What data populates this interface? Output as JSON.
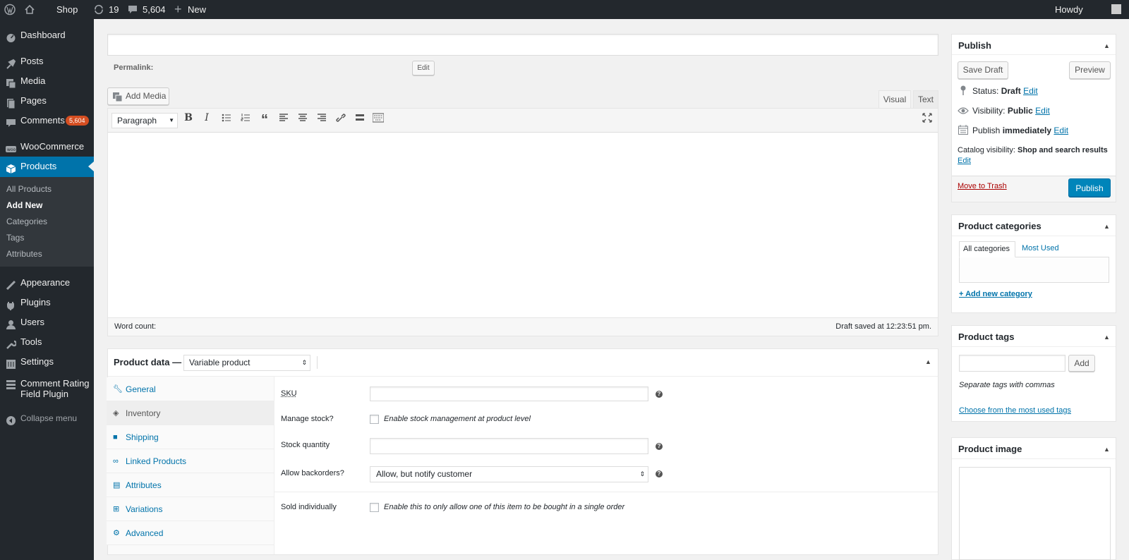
{
  "adminbar": {
    "site_name": "Shop",
    "updates_count": "19",
    "comments_count": "5,604",
    "new_label": "New",
    "howdy": "Howdy"
  },
  "sidebar": {
    "dashboard": "Dashboard",
    "posts": "Posts",
    "media": "Media",
    "pages": "Pages",
    "comments": "Comments",
    "comments_badge": "5,604",
    "woocommerce": "WooCommerce",
    "products": "Products",
    "sub": [
      "All Products",
      "Add New",
      "Categories",
      "Tags",
      "Attributes"
    ],
    "appearance": "Appearance",
    "plugins": "Plugins",
    "users": "Users",
    "tools": "Tools",
    "settings": "Settings",
    "comment_rating": "Comment Rating Field Plugin",
    "collapse": "Collapse menu"
  },
  "editor": {
    "title_value": "",
    "permalink_label": "Permalink:",
    "permalink_edit": "Edit",
    "add_media": "Add Media",
    "tab_visual": "Visual",
    "tab_text": "Text",
    "format_select": "Paragraph",
    "word_count": "Word count:",
    "draft_saved": "Draft saved at 12:23:51 pm."
  },
  "product_data": {
    "label": "Product data —",
    "type_select": "Variable product",
    "tabs": [
      "General",
      "Inventory",
      "Shipping",
      "Linked Products",
      "Attributes",
      "Variations",
      "Advanced"
    ],
    "sku_label": "SKU",
    "manage_stock_label": "Manage stock?",
    "manage_stock_desc": "Enable stock management at product level",
    "stock_qty_label": "Stock quantity",
    "backorders_label": "Allow backorders?",
    "backorders_value": "Allow, but notify customer",
    "sold_ind_label": "Sold individually",
    "sold_ind_desc": "Enable this to only allow one of this item to be bought in a single order"
  },
  "publish": {
    "title": "Publish",
    "save_draft": "Save Draft",
    "preview": "Preview",
    "status_label": "Status:",
    "status_value": "Draft",
    "visibility_label": "Visibility:",
    "visibility_value": "Public",
    "publish_label": "Publish",
    "publish_value": "immediately",
    "catalog_label": "Catalog visibility:",
    "catalog_value": "Shop and search results",
    "edit": "Edit",
    "trash": "Move to Trash",
    "publish_button": "Publish"
  },
  "categories": {
    "title": "Product categories",
    "tab_all": "All categories",
    "tab_most": "Most Used",
    "add_new": "+ Add new category"
  },
  "tags": {
    "title": "Product tags",
    "input_value": "",
    "add": "Add",
    "hint": "Separate tags with commas",
    "choose": "Choose from the most used tags"
  },
  "image": {
    "title": "Product image"
  },
  "colors": {
    "adminbar": "#23282d",
    "active_menu": "#0073aa",
    "link": "#0073aa",
    "badge": "#d54e21",
    "trash": "#a00"
  }
}
